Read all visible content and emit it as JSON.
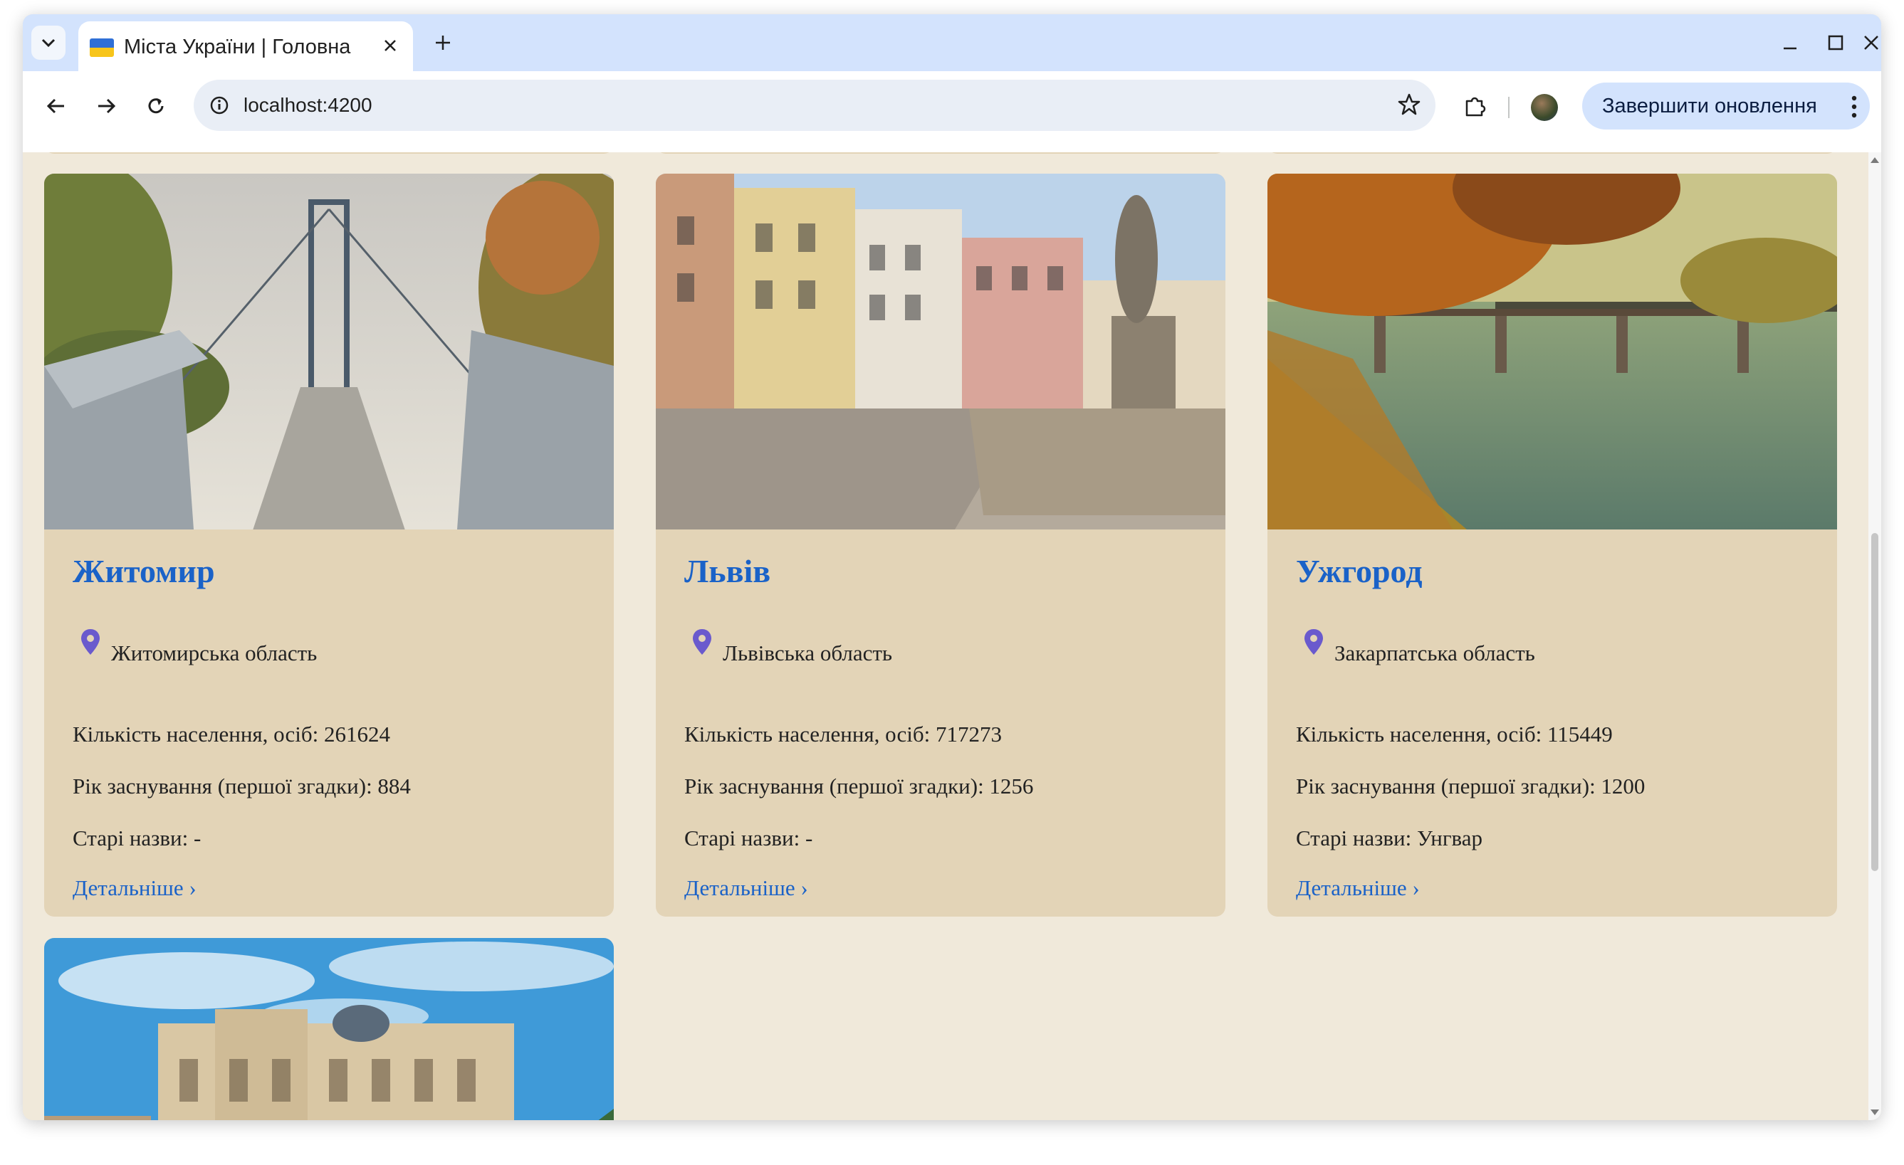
{
  "browser": {
    "tab_title": "Міста України | Головна",
    "url": "localhost:4200",
    "update_button": "Завершити оновлення"
  },
  "cities": [
    {
      "name": "Житомир",
      "region": "Житомирська область",
      "population": "Кількість населення, осіб: 261624",
      "founded": "Рік заснування (першої згадки): 884",
      "old_names": "Старі назви: -",
      "more": "Детальніше ›"
    },
    {
      "name": "Львів",
      "region": "Львівська область",
      "population": "Кількість населення, осіб: 717273",
      "founded": "Рік заснування (першої згадки): 1256",
      "old_names": "Старі назви: -",
      "more": "Детальніше ›"
    },
    {
      "name": "Ужгород",
      "region": "Закарпатська область",
      "population": "Кількість населення, осіб: 115449",
      "founded": "Рік заснування (першої згадки): 1200",
      "old_names": "Старі назви: Унгвар",
      "more": "Детальніше ›"
    }
  ],
  "colors": {
    "page_bg": "#f0e9da",
    "card_bg": "#e3d4b7",
    "link": "#1a62c8",
    "pin": "#6a5acd",
    "tabstrip": "#d3e3fd"
  },
  "icons": [
    "tab-search-icon",
    "ukraine-flag-icon",
    "close-icon",
    "plus-icon",
    "minimize-icon",
    "maximize-icon",
    "back-icon",
    "forward-icon",
    "reload-icon",
    "site-info-icon",
    "bookmark-star-icon",
    "extensions-icon",
    "kebab-menu-icon",
    "map-pin-icon"
  ]
}
